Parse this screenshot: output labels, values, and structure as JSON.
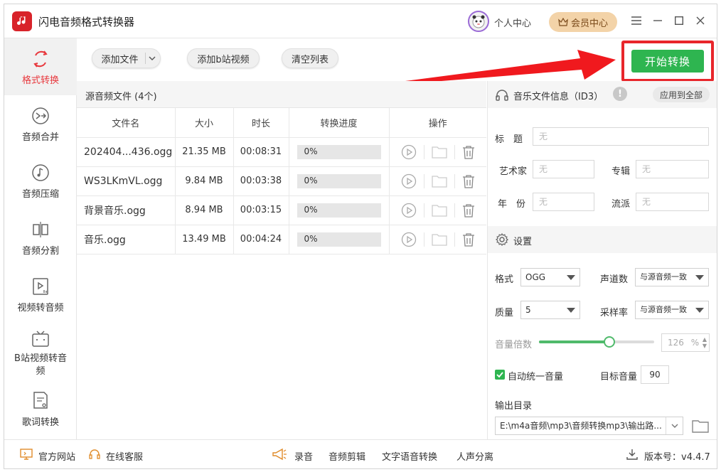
{
  "app": {
    "title": "闪电音频格式转换器"
  },
  "header": {
    "user_center": "个人中心",
    "vip": "会员中心"
  },
  "sidebar": {
    "items": [
      {
        "label": "格式转换",
        "active": true
      },
      {
        "label": "音频合并"
      },
      {
        "label": "音频压缩"
      },
      {
        "label": "音频分割"
      },
      {
        "label": "视频转音频"
      },
      {
        "label": "B站视频转音频"
      },
      {
        "label": "歌词转换"
      }
    ]
  },
  "toolbar": {
    "add_file": "添加文件",
    "add_bilibili": "添加b站视频",
    "clear": "清空列表",
    "start": "开始转换"
  },
  "files": {
    "title": "源音频文件 (4个)",
    "columns": [
      "文件名",
      "大小",
      "时长",
      "转换进度",
      "操作"
    ],
    "rows": [
      {
        "name": "202404...436.ogg",
        "size": "21.35 MB",
        "duration": "00:08:31",
        "progress": "0%",
        "progress_value": 0
      },
      {
        "name": "WS3LKmVL.ogg",
        "size": "9.84 MB",
        "duration": "00:03:38",
        "progress": "0%",
        "progress_value": 0
      },
      {
        "name": "背景音乐.ogg",
        "size": "8.94 MB",
        "duration": "00:03:15",
        "progress": "0%",
        "progress_value": 0
      },
      {
        "name": "音乐.ogg",
        "size": "13.49 MB",
        "duration": "00:04:24",
        "progress": "0%",
        "progress_value": 0
      }
    ]
  },
  "info": {
    "title": "音乐文件信息（ID3）",
    "apply_all": "应用到全部",
    "title_label": "标　题",
    "artist_label": "艺术家",
    "album_label": "专辑",
    "year_label": "年　份",
    "genre_label": "流派",
    "empty": "无"
  },
  "settings": {
    "title": "设置",
    "format_label": "格式",
    "format_value": "OGG",
    "channel_label": "声道数",
    "channel_value": "与源音频一致",
    "quality_label": "质量",
    "quality_value": "5",
    "samplerate_label": "采样率",
    "samplerate_value": "与源音频一致",
    "volume_label": "音量倍数",
    "volume_value": "126",
    "volume_unit": "%",
    "volume_fraction": 0.61,
    "auto_volume_label": "自动统一音量",
    "auto_volume_checked": true,
    "target_volume_label": "目标音量",
    "target_volume_value": "90",
    "output_label": "输出目录",
    "output_value": "E:\\m4a音频\\mp3\\音频转换mp3\\输出路..."
  },
  "footer": {
    "website": "官方网站",
    "service": "在线客服",
    "record": "录音",
    "edit": "音频剪辑",
    "tts": "文字语音转换",
    "vocal": "人声分离",
    "version": "版本号：v4.4.7"
  },
  "colors": {
    "accent": "#e8383d",
    "green": "#2eb550",
    "vip": "#f3d3a8"
  }
}
